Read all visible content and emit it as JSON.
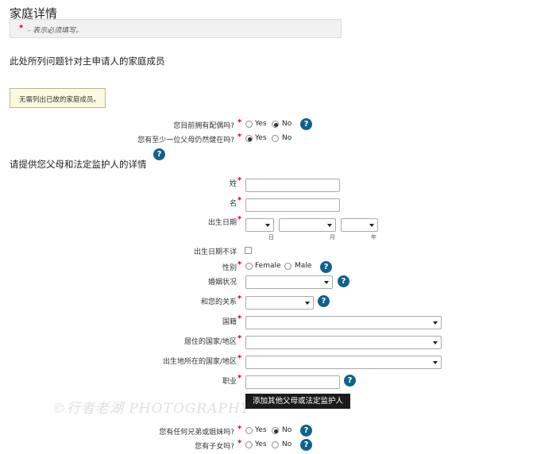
{
  "page": {
    "title": "家庭详情",
    "required_star": "*",
    "required_note": "- 表示必须填写。"
  },
  "family_section": {
    "heading": "此处所列问题针对主申请人的家庭成员",
    "info": "无需列出已故的家庭成员。"
  },
  "spouse_question": {
    "label": "您目前拥有配偶吗?",
    "options": [
      "Yes",
      "No"
    ],
    "selected": "No"
  },
  "parent_alive_question": {
    "label": "您有至少一位父母仍然健在吗?",
    "options": [
      "Yes",
      "No"
    ],
    "selected": "Yes"
  },
  "parents_section": {
    "heading": "请提供您父母和法定监护人的详情"
  },
  "form": {
    "surname_label": "姓",
    "given_name_label": "名",
    "dob_label": "出生日期",
    "dob_day_caption": "日",
    "dob_month_caption": "月",
    "dob_year_caption": "年",
    "dob_unknown_label": "出生日期不详",
    "gender_label": "性别",
    "gender_options": [
      "Female",
      "Male"
    ],
    "marital_status_label": "婚姻状况",
    "relationship_label": "和您的关系",
    "nationality_label": "国籍",
    "residence_country_label": "居住的国家/地区",
    "birth_country_label": "出生地所在的国家/地区",
    "occupation_label": "职业"
  },
  "add_parent_button": "添加其他父母或法定监护人",
  "watermark": "©行者老湖 PHOTOGRAPHY",
  "siblings_question": {
    "label": "您有任何兄弟或姐妹吗?",
    "options": [
      "Yes",
      "No"
    ],
    "selected": "No"
  },
  "children_question": {
    "label": "您有子女吗?",
    "options": [
      "Yes",
      "No"
    ],
    "selected": "none"
  },
  "help_icon_glyph": "?",
  "colors": {
    "required": "#d0021b",
    "help_icon": "#10628c",
    "button_bg": "#1b1b1b"
  }
}
